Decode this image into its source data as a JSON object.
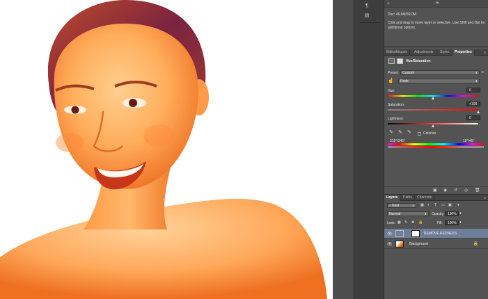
{
  "info": {
    "doc_size": "Doc: 46.6M/39.0M",
    "hint": "Click and drag to move layer or selection.  Use Shift and Opt for additional options.",
    "top_labels": [
      "+.",
      "H:"
    ]
  },
  "tabs_upper": [
    "Bibliothèques",
    "Adjustments",
    "Styles",
    "Properties"
  ],
  "properties": {
    "title": "Hue/Saturation",
    "preset_label": "Preset:",
    "preset_value": "Custom",
    "channel_value": "Reds",
    "hue_label": "Hue:",
    "hue_value": "0",
    "hue_level": 0.5,
    "saturation_label": "Saturation:",
    "saturation_value": "+100",
    "saturation_level": 1.0,
    "lightness_label": "Lightness:",
    "lightness_value": "0",
    "lightness_level": 0.5,
    "colorize_label": "Colorize",
    "range_left": "315°/345°",
    "range_right": "15°\\45°"
  },
  "tabs_lower": [
    "Layers",
    "Paths",
    "Channels"
  ],
  "layers_panel": {
    "filter_kind": "Kind",
    "blend_mode": "Normal",
    "opacity_label": "Opacity:",
    "opacity_value": "100%",
    "lock_label": "Lock:",
    "fill_label": "Fill:",
    "fill_value": "100%",
    "layers": [
      {
        "name": "REMOVE REDNESS",
        "selected": true
      },
      {
        "name": "Background",
        "selected": false
      }
    ]
  },
  "colors": {
    "skin_light": "#ffb56e",
    "skin_mid": "#ff8a3a",
    "skin_dark": "#e0601a",
    "hair": "#8a2a3a",
    "selected_layer": "#6d7e96",
    "panel_bg": "#535353"
  }
}
